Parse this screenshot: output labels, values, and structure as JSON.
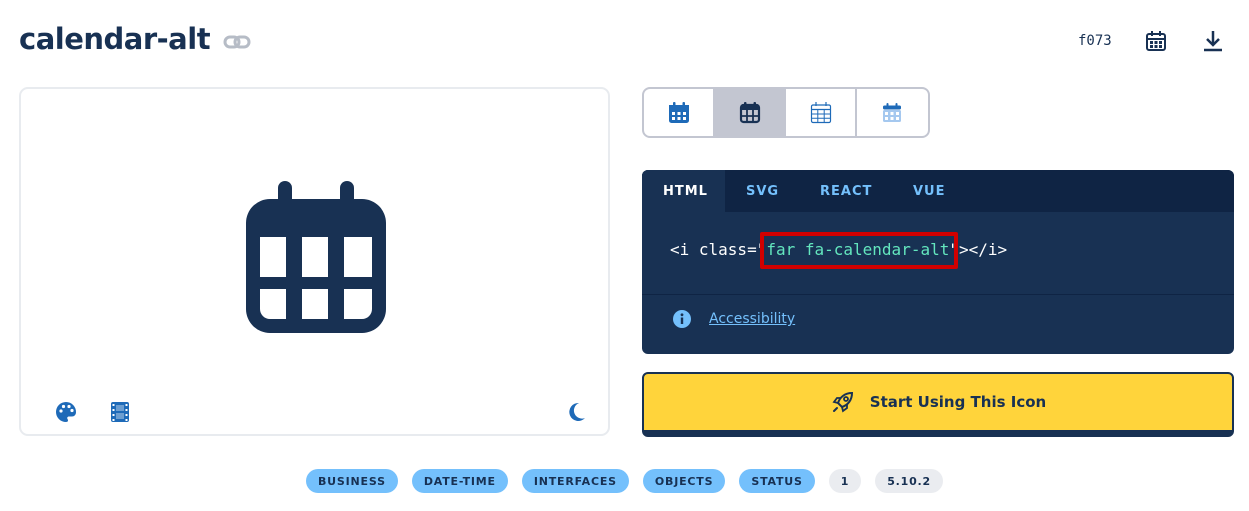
{
  "header": {
    "title": "calendar-alt",
    "link_icon": "link-icon",
    "unicode": "f073",
    "calendar_icon": "calendar-icon",
    "download_icon": "download-icon"
  },
  "preview": {
    "icon": "calendar-alt-icon",
    "tools": [
      "palette-icon",
      "film-icon",
      "moon-icon"
    ]
  },
  "style_options": [
    {
      "icon": "calendar-solid-icon",
      "active": false
    },
    {
      "icon": "calendar-regular-icon",
      "active": true
    },
    {
      "icon": "calendar-light-icon",
      "active": false
    },
    {
      "icon": "calendar-duotone-icon",
      "active": false
    }
  ],
  "code_panel": {
    "tabs": [
      {
        "label": "HTML",
        "active": true
      },
      {
        "label": "SVG",
        "active": false
      },
      {
        "label": "REACT",
        "active": false
      },
      {
        "label": "VUE",
        "active": false
      }
    ],
    "code_prefix": "<i class=\"",
    "code_class": "far fa-calendar-alt",
    "code_suffix": "\"></i>",
    "accessibility_label": "Accessibility",
    "accessibility_icon": "info-icon"
  },
  "cta": {
    "label": "Start Using This Icon",
    "icon": "rocket-icon"
  },
  "tags": [
    {
      "label": "BUSINESS",
      "style": "blue"
    },
    {
      "label": "DATE-TIME",
      "style": "blue"
    },
    {
      "label": "INTERFACES",
      "style": "blue"
    },
    {
      "label": "OBJECTS",
      "style": "blue"
    },
    {
      "label": "STATUS",
      "style": "blue"
    },
    {
      "label": "1",
      "style": "gray"
    },
    {
      "label": "5.10.2",
      "style": "gray"
    }
  ],
  "colors": {
    "navy": "#183153",
    "dark_navy": "#0f2444",
    "accent_blue": "#74c0fc",
    "icon_blue": "#1e6ab8",
    "yellow": "#ffd43b",
    "code_green": "#63e6be",
    "highlight_red": "#d10000"
  }
}
